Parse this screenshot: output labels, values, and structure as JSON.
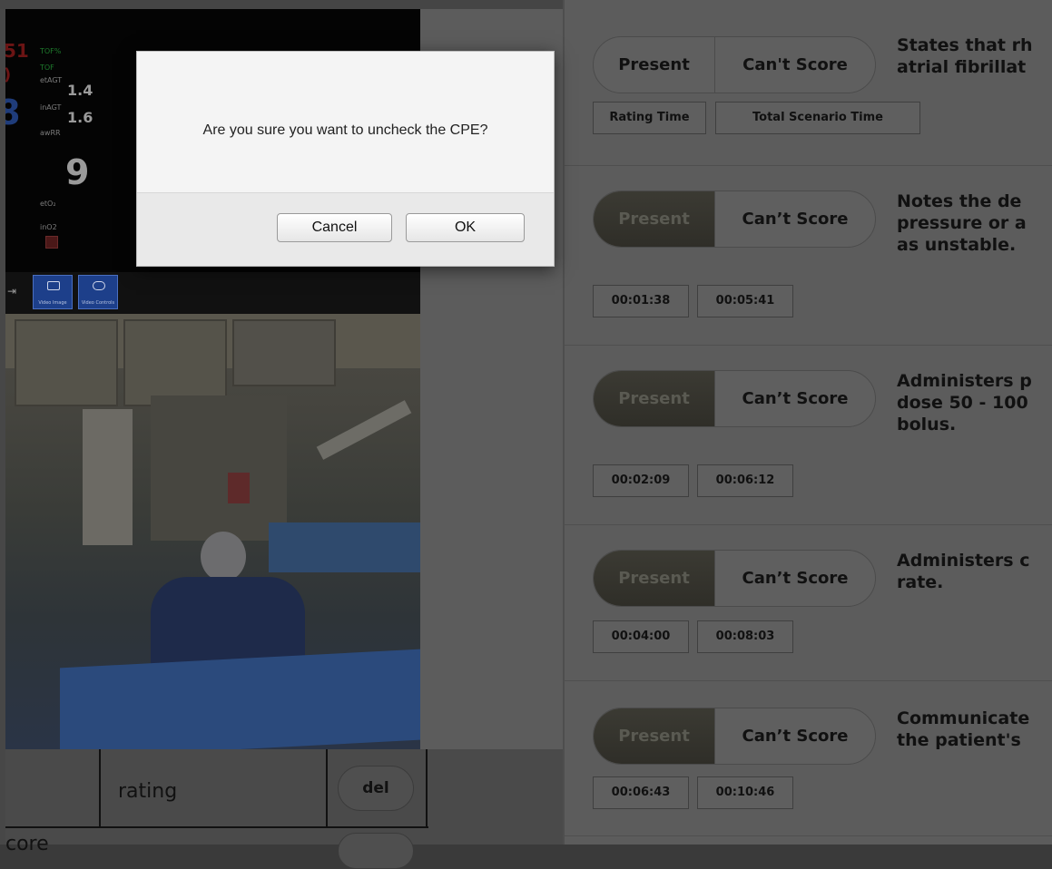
{
  "dialog": {
    "message": "Are you sure you want to uncheck the CPE?",
    "cancel_label": "Cancel",
    "ok_label": "OK"
  },
  "monitor": {
    "labels": {
      "tofs": "TOF%",
      "tof": "TOF",
      "etagt": "etAGT",
      "inagt": "inAGT",
      "awrr": "awRR",
      "eto2": "etO₂",
      "ino2": "inO2"
    },
    "values": {
      "red_partial": "51",
      "etagt": "1.4",
      "inagt": "1.6",
      "awrr": "9",
      "blue_partial": "8"
    },
    "buttons": [
      {
        "label": "Video Image",
        "icon": "monitor-icon"
      },
      {
        "label": "Video Controls",
        "icon": "screen-icon"
      }
    ]
  },
  "table": {
    "header_rating": "rating",
    "del_label": "del",
    "row_partial_text": "core"
  },
  "rating_items": [
    {
      "present_label": "Present",
      "cant_score_label": "Can't Score",
      "present_selected": false,
      "description": [
        "States that rh",
        "atrial fibrillat"
      ],
      "times": [
        "Rating Time",
        "Total Scenario Time"
      ]
    },
    {
      "present_label": "Present",
      "cant_score_label": "Can’t Score",
      "present_selected": true,
      "description": [
        "Notes the de",
        "pressure or a",
        "as unstable."
      ],
      "times": [
        "00:01:38",
        "00:05:41"
      ]
    },
    {
      "present_label": "Present",
      "cant_score_label": "Can’t Score",
      "present_selected": true,
      "description": [
        "Administers p",
        "dose 50 - 100",
        "bolus."
      ],
      "times": [
        "00:02:09",
        "00:06:12"
      ]
    },
    {
      "present_label": "Present",
      "cant_score_label": "Can’t Score",
      "present_selected": true,
      "description": [
        "Administers c",
        "rate."
      ],
      "times": [
        "00:04:00",
        "00:08:03"
      ]
    },
    {
      "present_label": "Present",
      "cant_score_label": "Can’t Score",
      "present_selected": true,
      "description": [
        "Communicate",
        "the patient's"
      ],
      "times": [
        "00:06:43",
        "00:10:46"
      ]
    }
  ],
  "colors": {
    "overlay_dim": "#5c5c5c",
    "selected_segment": "#2f2e28",
    "dialog_bg": "#f4f4f4"
  }
}
